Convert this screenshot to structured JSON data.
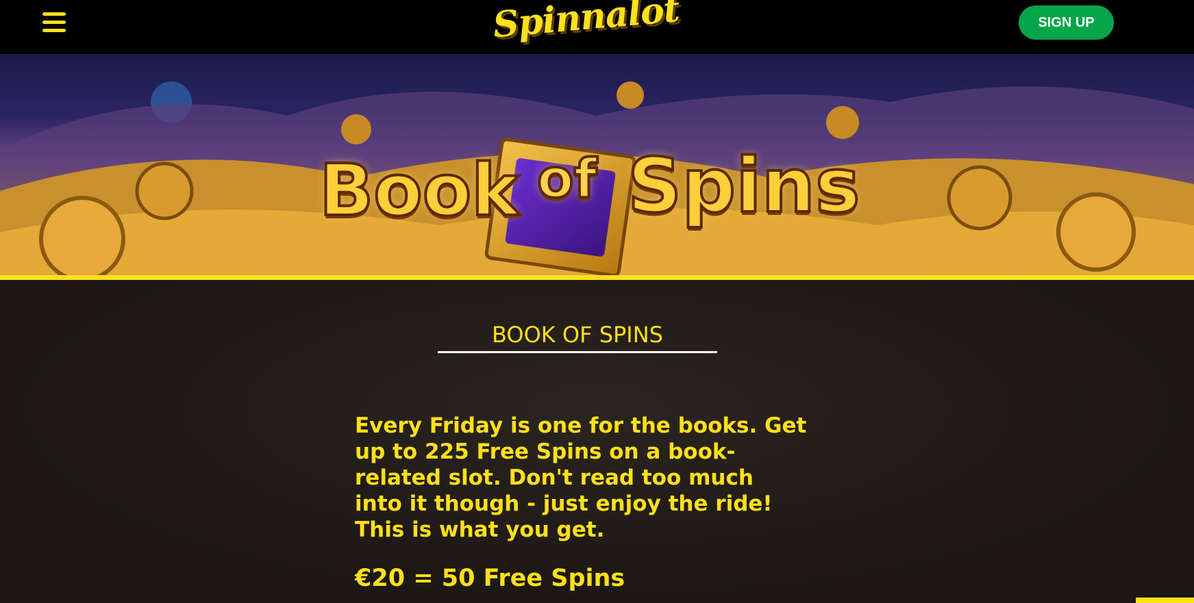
{
  "header": {
    "logo_text": "Spinnalot",
    "signup_label": "SIGN UP",
    "menu_icon": "hamburger-menu-icon"
  },
  "banner": {
    "title_book": "Book",
    "title_of": "of",
    "title_spins": "Spins"
  },
  "promo": {
    "title": "BOOK OF SPINS",
    "description": "Every Friday is one for the books. Get up to 225 Free Spins on a book-related slot. Don't read too much into it though - just enjoy the ride! This is what you get.",
    "offers": [
      "€20 = 50 Free Spins"
    ]
  },
  "colors": {
    "accent": "#ffe01b",
    "signup": "#05a54a",
    "header_bg": "#000000",
    "content_bg": "#1e1815"
  }
}
